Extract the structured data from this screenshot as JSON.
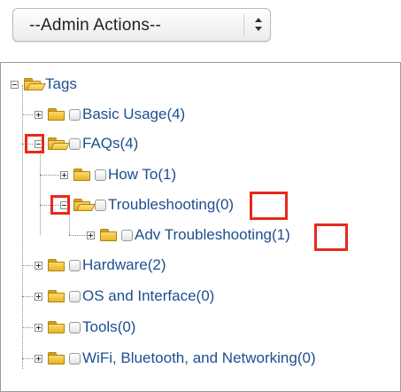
{
  "admin_actions": {
    "selected": "--Admin Actions--"
  },
  "tree": {
    "root": {
      "label": "Tags"
    },
    "items": [
      {
        "label": "Basic Usage",
        "count": "(4)"
      },
      {
        "label": "FAQs",
        "count": "(4)"
      },
      {
        "label": "How To",
        "count": "(1)"
      },
      {
        "label": "Troubleshooting",
        "count": "(0)"
      },
      {
        "label": "Adv Troubleshooting",
        "count": "(1)"
      },
      {
        "label": "Hardware",
        "count": "(2)"
      },
      {
        "label": "OS and Interface",
        "count": "(0)"
      },
      {
        "label": "Tools",
        "count": "(0)"
      },
      {
        "label": "WiFi, Bluetooth, and Networking",
        "count": "(0)"
      }
    ]
  },
  "colors": {
    "link": "#1d4f8e",
    "highlight": "#e8291c",
    "folder": "#f0c23c"
  },
  "icons": [
    "chevron-updown-icon",
    "expand-icon",
    "collapse-icon",
    "folder-icon",
    "folder-open-icon",
    "checkbox-icon"
  ]
}
